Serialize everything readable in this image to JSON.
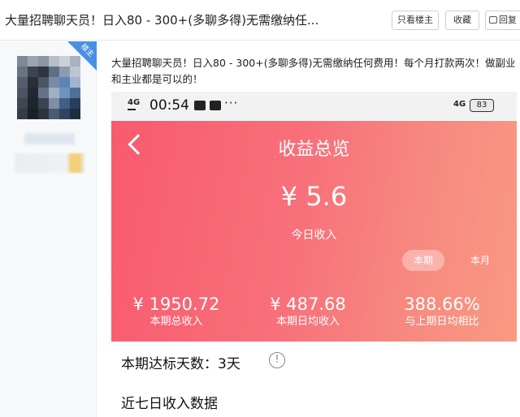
{
  "header": {
    "title": "大量招聘聊天员！日入80 - 300+(多聊多得)无需缴纳任...",
    "only_op_label": "只看楼主",
    "favorite_label": "收藏",
    "reply_label": "回复"
  },
  "author": {
    "op_badge": "楼主"
  },
  "post": {
    "text": "大量招聘聊天员！日入80 - 300+(多聊多得)无需缴纳任何费用！每个月打款两次！做副业和主业都是可以的！"
  },
  "phone": {
    "status": {
      "signal_left": "4G",
      "time": "00:54",
      "more": "···",
      "signal_right": "4G",
      "battery": "83"
    },
    "card": {
      "title": "收益总览",
      "today_amount": "¥ 5.6",
      "today_label": "今日收入",
      "tab_current": "本期",
      "tab_month": "本月",
      "stats": [
        {
          "value": "¥ 1950.72",
          "label": "本期总收入"
        },
        {
          "value": "¥ 487.68",
          "label": "本期日均收入"
        },
        {
          "value": "388.66%",
          "label": "与上期日均相比"
        }
      ]
    },
    "days_label": "本期达标天数：3天",
    "info_glyph": "!",
    "seven_day_title": "近七日收入数据"
  },
  "colors": {
    "card_gradient_start": "#f95a6d",
    "card_gradient_end": "#f99a82",
    "op_badge": "#4a8fe7"
  }
}
